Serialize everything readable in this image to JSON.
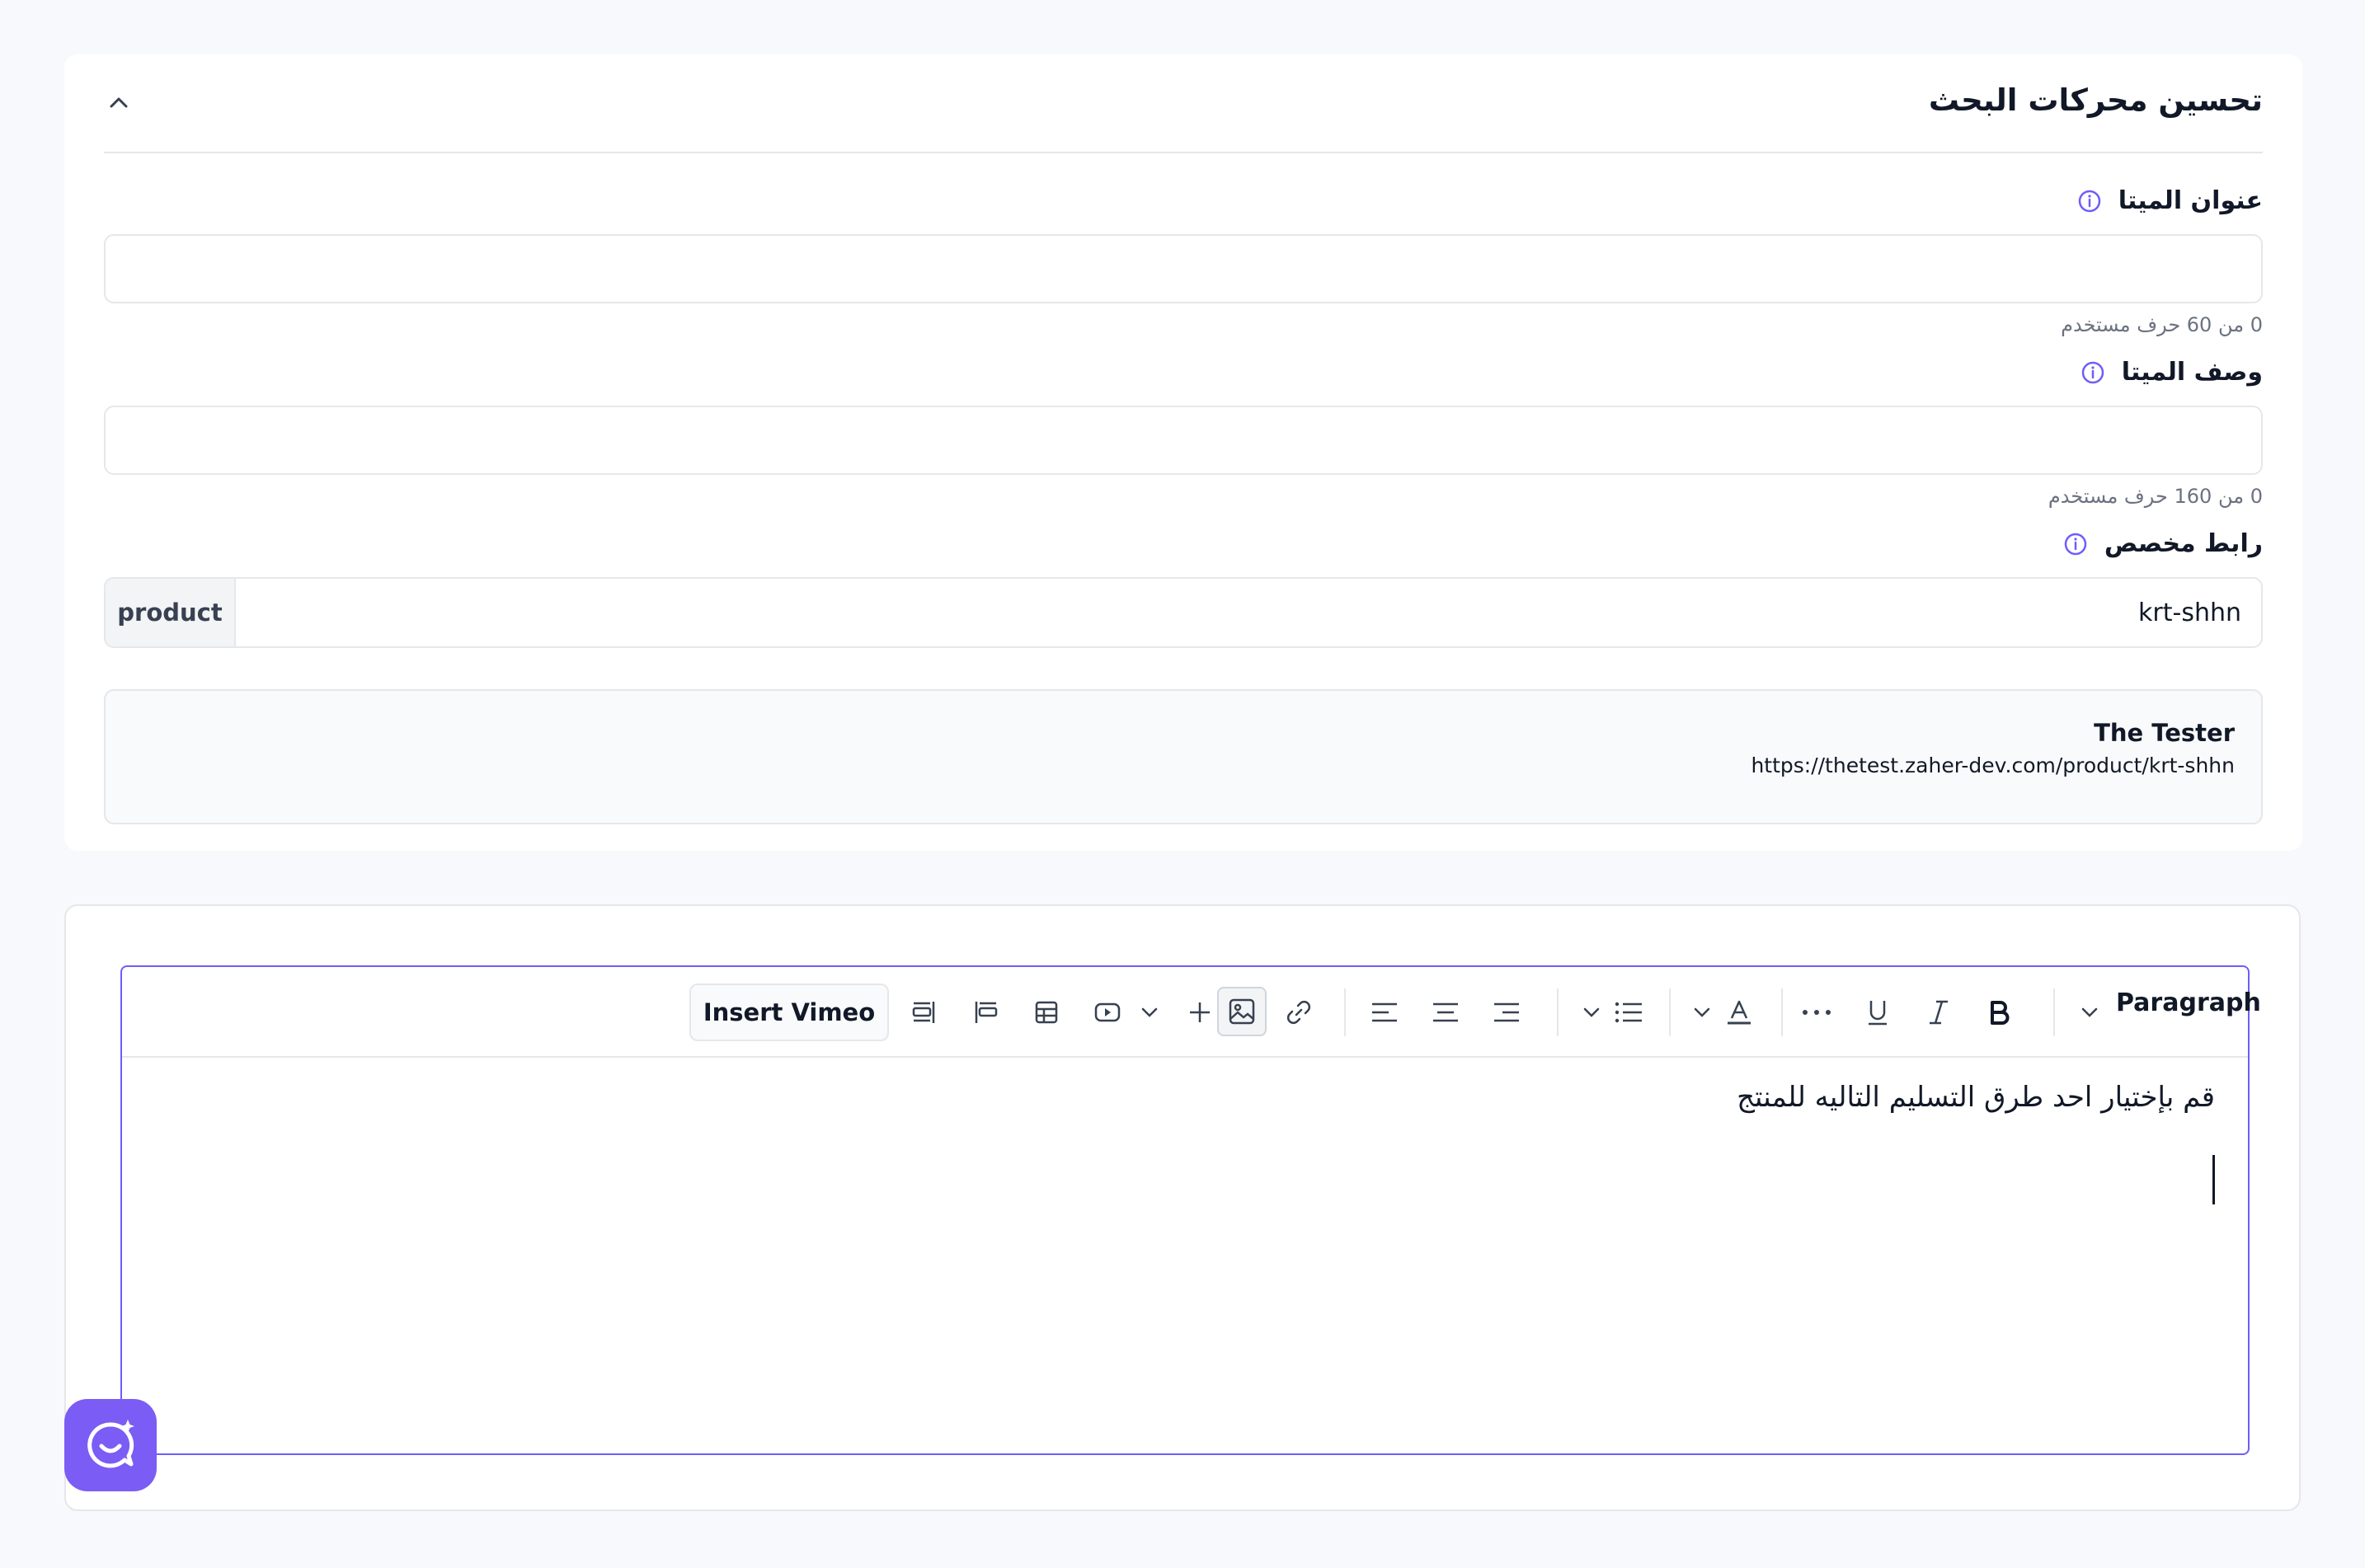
{
  "seo": {
    "title": "تحسين محركات البحث",
    "meta_title": {
      "label": "عنوان الميتا",
      "value": "",
      "counter": "0 من 60 حرف مستخدم"
    },
    "meta_description": {
      "label": "وصف الميتا",
      "value": "",
      "counter": "0 من 160 حرف مستخدم"
    },
    "custom_link": {
      "label": "رابط مخصص",
      "prefix": "product",
      "value": "krt-shhn"
    },
    "preview": {
      "title": "The Tester",
      "url": "https://thetest.zaher-dev.com/product/krt-shhn"
    }
  },
  "editor": {
    "toolbar": {
      "block_type": "Paragraph",
      "insert_vimeo": "Insert Vimeo",
      "icons": [
        "chevron-down-icon",
        "bold-icon",
        "italic-icon",
        "underline-icon",
        "more-icon",
        "text-color-icon",
        "list-icon",
        "align-right-icon",
        "align-center-icon",
        "align-left-icon",
        "link-icon",
        "image-icon",
        "plus-icon",
        "video-icon",
        "table-icon",
        "align-start-icon",
        "align-end-icon"
      ]
    },
    "content": "قم بإختيار احد طرق التسليم التاليه للمنتج"
  },
  "colors": {
    "accent": "#6d5dfc",
    "fab": "#7b5cf5",
    "border": "#e5e7eb"
  }
}
